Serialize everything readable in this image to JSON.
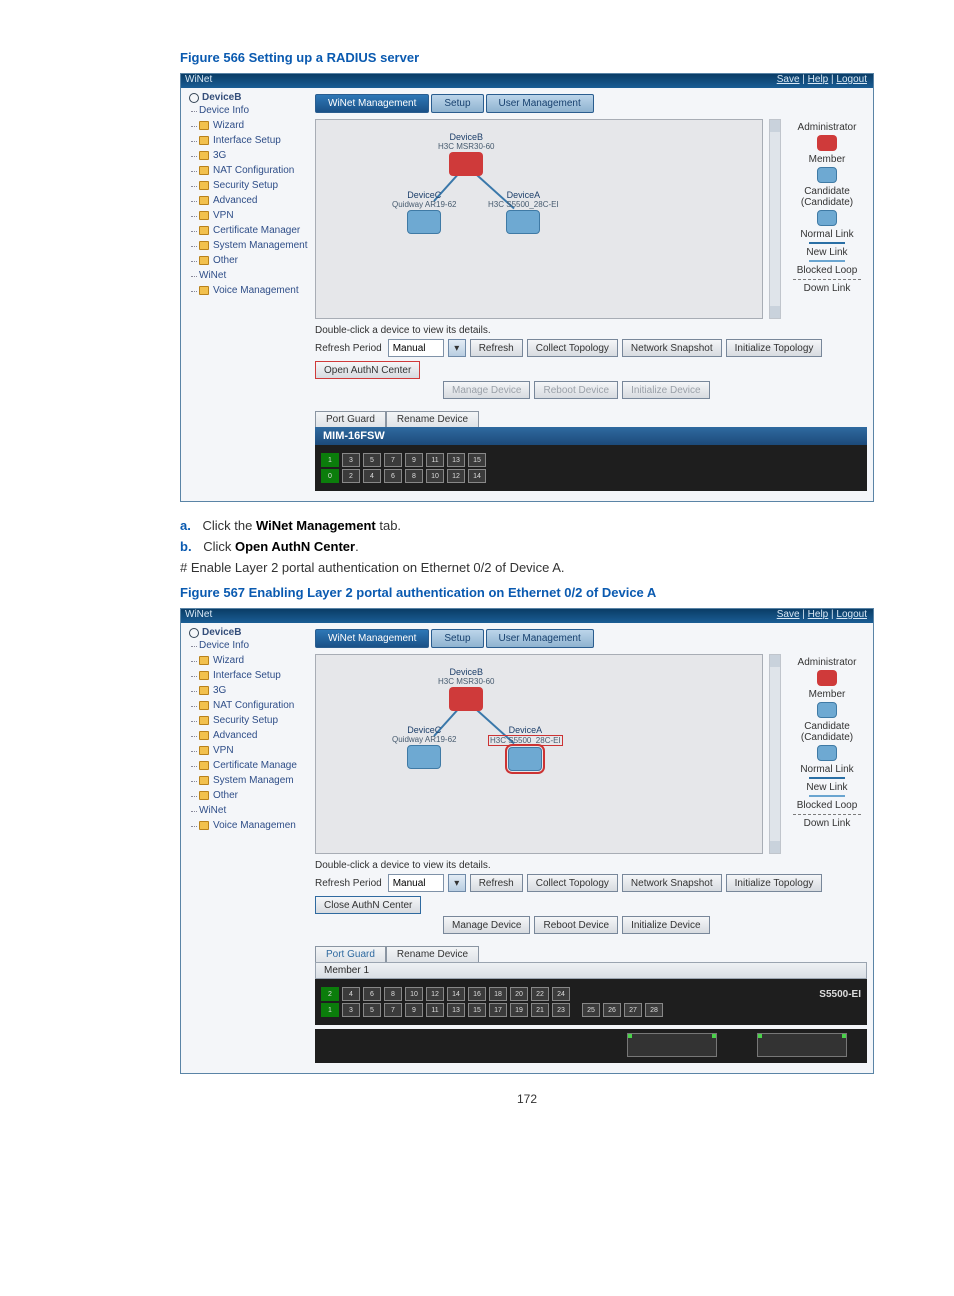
{
  "page_number": "172",
  "figures": {
    "f566": {
      "caption": "Figure 566 Setting up a RADIUS server"
    },
    "f567": {
      "caption": "Figure 567 Enabling Layer 2 portal authentication on Ethernet 0/2 of Device A"
    }
  },
  "instructions": {
    "step_a_marker": "a.",
    "step_a_prefix": "Click the ",
    "step_a_bold": "WiNet Management",
    "step_a_suffix": " tab.",
    "step_b_marker": "b.",
    "step_b_prefix": "Click ",
    "step_b_bold": "Open AuthN Center",
    "step_b_suffix": ".",
    "note": "# Enable Layer 2 portal authentication on Ethernet 0/2 of Device A."
  },
  "app": {
    "title": "WiNet",
    "header_links": {
      "save": "Save",
      "help": "Help",
      "logout": "Logout",
      "sep": " | "
    }
  },
  "nav": {
    "root": "DeviceB",
    "items": [
      "Device Info",
      "Wizard",
      "Interface Setup",
      "3G",
      "NAT Configuration",
      "Security Setup",
      "Advanced",
      "VPN",
      "Certificate Manager",
      "System Management",
      "Other",
      "WiNet",
      "Voice Management"
    ],
    "items_f567": [
      "Device Info",
      "Wizard",
      "Interface Setup",
      "3G",
      "NAT Configuration",
      "Security Setup",
      "Advanced",
      "VPN",
      "Certificate Manage",
      "System Managem",
      "Other",
      "WiNet",
      "Voice Managemen"
    ]
  },
  "tabs": {
    "t1": "WiNet Management",
    "t2": "Setup",
    "t3": "User Management"
  },
  "legend": {
    "admin": "Administrator",
    "member": "Member",
    "candidate": "Candidate (Candidate)",
    "normal": "Normal Link",
    "newlink": "New Link",
    "blocked": "Blocked Loop",
    "down": "Down Link"
  },
  "topo": {
    "devB": {
      "name": "DeviceB",
      "model": "H3C MSR30-60"
    },
    "devC": {
      "name": "DeviceC",
      "model": "Quidway AR19-62"
    },
    "devA": {
      "name": "DeviceA",
      "model": "H3C S5500_28C-EI"
    }
  },
  "hint": "Double-click a device to view its details.",
  "controls": {
    "refresh_label": "Refresh Period",
    "refresh_value": "Manual",
    "refresh": "Refresh",
    "collect": "Collect Topology",
    "snapshot": "Network Snapshot",
    "init_topo": "Initialize Topology",
    "open_auth": "Open AuthN Center",
    "close_auth": "Close AuthN Center",
    "manage": "Manage Device",
    "reboot": "Reboot Device",
    "init_dev": "Initialize Device"
  },
  "subtabs": {
    "port_guard": "Port Guard",
    "rename": "Rename Device"
  },
  "device_panel_1": {
    "title": "MIM-16FSW",
    "row1": [
      "1",
      "3",
      "5",
      "7",
      "9",
      "11",
      "13",
      "15"
    ],
    "row2": [
      "0",
      "2",
      "4",
      "6",
      "8",
      "10",
      "12",
      "14"
    ]
  },
  "device_panel_2": {
    "tab": "Member 1",
    "model": "S5500-EI",
    "row1": [
      "2",
      "4",
      "6",
      "8",
      "10",
      "12",
      "14",
      "16",
      "18",
      "20",
      "22",
      "24"
    ],
    "row2": [
      "1",
      "3",
      "5",
      "7",
      "9",
      "11",
      "13",
      "15",
      "17",
      "19",
      "21",
      "23"
    ],
    "row2b": [
      "25",
      "26",
      "27",
      "28"
    ]
  }
}
